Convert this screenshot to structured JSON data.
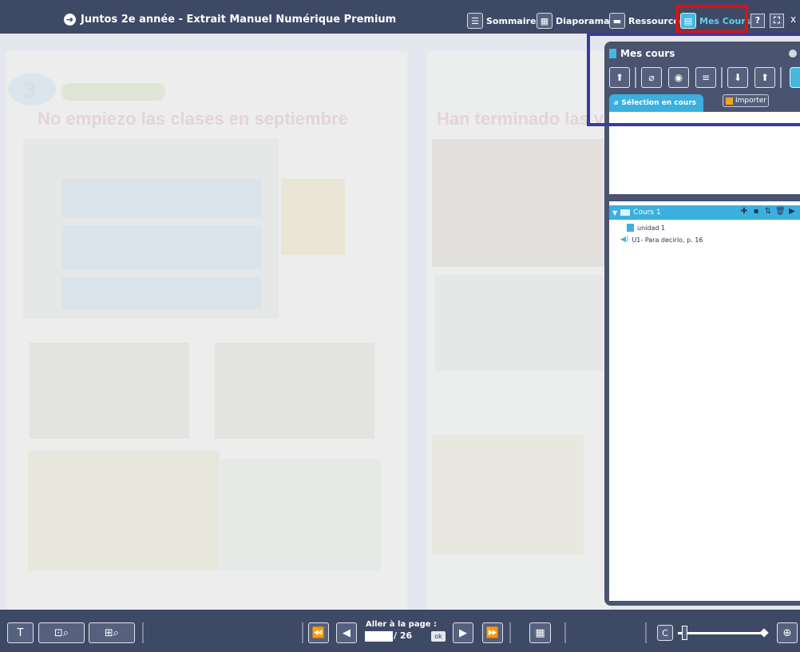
{
  "window": {
    "title": "Juntos 2e année - Extrait Manuel Numérique Premium"
  },
  "toolbar": {
    "items": [
      {
        "label": "Sommaire",
        "icon": "list-icon"
      },
      {
        "label": "Diaporama",
        "icon": "grid-icon"
      },
      {
        "label": "Ressources",
        "icon": "folder-icon"
      },
      {
        "label": "Mes Cours",
        "icon": "book-icon",
        "active": true
      }
    ],
    "help_label": "?",
    "fullscreen_icon": "fullscreen-icon",
    "close_label": "x"
  },
  "page": {
    "lesson_number": "3",
    "left_heading": "No empiezo las clases en septiembre",
    "right_heading": "Han terminado las v"
  },
  "panel": {
    "title": "Mes cours",
    "tools": [
      "export-icon",
      "attach-icon",
      "camera-icon",
      "quiz-icon",
      "download-icon",
      "upload-icon"
    ],
    "tab_label": "Sélection en cours",
    "import_label": "Importer",
    "tree": {
      "root_label": "Cours 1",
      "items": [
        {
          "label": "unidad 1",
          "type": "document"
        },
        {
          "label": "U1- Para decirlo, p. 16",
          "type": "audio"
        }
      ]
    }
  },
  "bottombar": {
    "goto_label": "Aller à la page :",
    "page_value": "",
    "page_total": "/ 26",
    "ok_label": "ok",
    "zoom_level": 0.08
  },
  "colors": {
    "bar": "#3e4966",
    "accent": "#3bb0de",
    "highlight_red": "#e01010",
    "highlight_blue": "#3a3b9a"
  }
}
